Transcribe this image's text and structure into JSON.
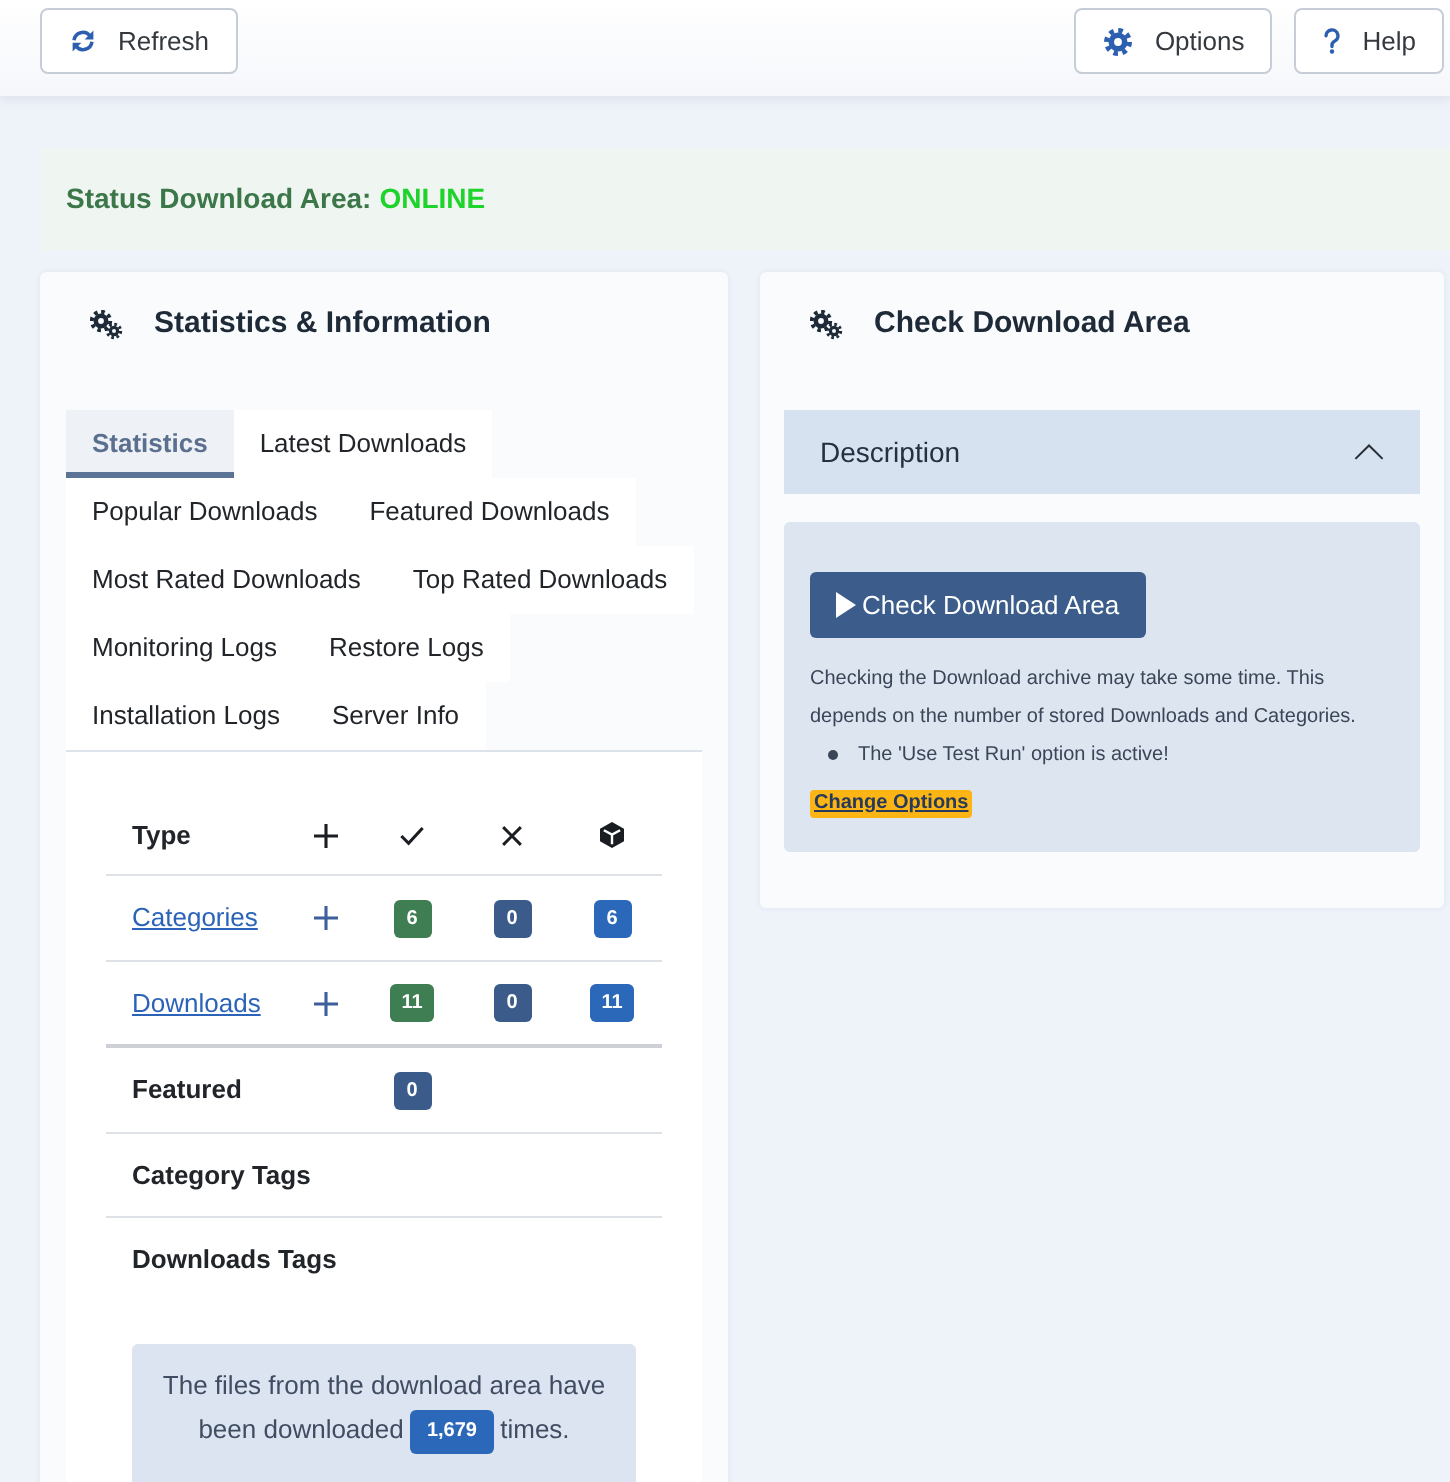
{
  "toolbar": {
    "left": [
      {
        "label": "Refresh",
        "kind": "refresh"
      }
    ],
    "right": [
      {
        "label": "Options",
        "kind": "options"
      },
      {
        "label": "Help",
        "kind": "help"
      }
    ]
  },
  "status": {
    "label": "Status Download Area:",
    "value": "ONLINE",
    "online": true
  },
  "statistics_panel": {
    "title": "Statistics & Information",
    "tabs": [
      {
        "label": "Statistics",
        "selected": true
      },
      {
        "label": "Latest Downloads",
        "selected": false
      },
      {
        "label": "Popular Downloads",
        "selected": false
      },
      {
        "label": "Featured Downloads",
        "selected": false
      },
      {
        "label": "Most Rated Downloads",
        "selected": false
      },
      {
        "label": "Top Rated Downloads",
        "selected": false
      },
      {
        "label": "Monitoring Logs",
        "selected": false
      },
      {
        "label": "Restore Logs",
        "selected": false
      },
      {
        "label": "Installation Logs",
        "selected": false
      },
      {
        "label": "Server Info",
        "selected": false
      }
    ],
    "table": {
      "columns": [
        {
          "kind": "label",
          "label": "Type"
        },
        {
          "kind": "add"
        },
        {
          "kind": "published"
        },
        {
          "kind": "unpublished"
        },
        {
          "kind": "total"
        }
      ],
      "row_groups": [
        [
          {
            "label": "Categories",
            "link": true,
            "add": true,
            "counts": {
              "published": {
                "value": "6",
                "color": "#3f7d52"
              },
              "unpublished": {
                "value": "0",
                "color": "#3b5b8a"
              },
              "total": {
                "value": "6",
                "color": "#2b68ba"
              }
            }
          },
          {
            "label": "Downloads",
            "link": true,
            "add": true,
            "counts": {
              "published": {
                "value": "11",
                "color": "#3f7d52"
              },
              "unpublished": {
                "value": "0",
                "color": "#3b5b8a"
              },
              "total": {
                "value": "11",
                "color": "#2b68ba"
              }
            }
          }
        ],
        [
          {
            "label": "Featured",
            "link": false,
            "add": false,
            "counts": {
              "published": {
                "value": "0",
                "color": "#3b5b8a"
              }
            }
          },
          {
            "label": "Category Tags",
            "link": false,
            "add": false
          },
          {
            "label": "Downloads Tags",
            "link": false,
            "add": false
          }
        ]
      ]
    },
    "summary": {
      "text_before": "The files from the download area have been downloaded",
      "count": "1,679",
      "text_after": "times."
    }
  },
  "check_panel": {
    "title": "Check Download Area",
    "accordion": {
      "title": "Description",
      "expanded": true,
      "button": {
        "label": "Check Download Area"
      },
      "text": "Checking the Download archive may take some time. This depends on the number of stored Downloads and Categories.",
      "notes": [
        "The 'Use Test Run' option is active!"
      ],
      "link": "Change Options"
    }
  }
}
